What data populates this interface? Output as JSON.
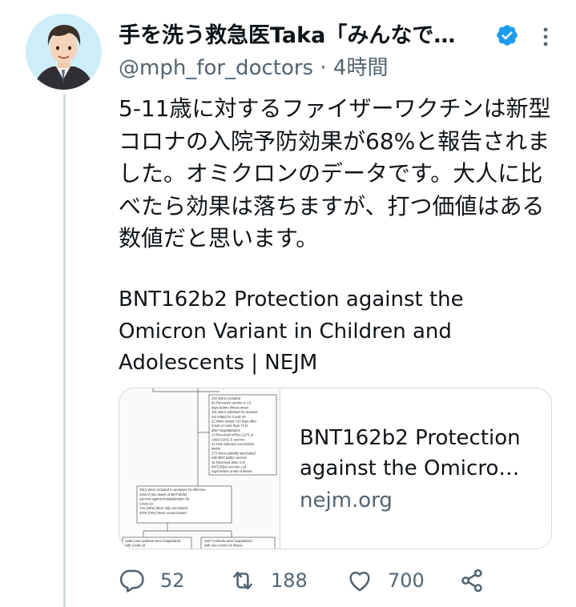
{
  "tweet": {
    "display_name": "手を洗う救急医Taka「みんなで…",
    "handle": "@mph_for_doctors",
    "separator": "·",
    "time": "4時間",
    "text": "5-11歳に対するファイザーワクチンは新型コロナの入院予防効果が68%と報告されました。オミクロンのデータです。大人に比べたら効果は落ちますが、打つ価値はある数値だと思います。",
    "link_title": "BNT162b2 Protection against the Omicron Variant in Children and Adolescents | NEJM"
  },
  "card": {
    "title_line1": "BNT162b2 Protection",
    "title_line2": "against the Omicro…",
    "domain": "nejm.org",
    "thumb": {
      "box1_lines": [
        "422 Were excluded",
        "60 Received vaccine 0–13",
        "days before illness onset",
        "101 Were admitted for reasons",
        "not related to Covid-19",
        "22 Were tested >10 days after",
        "onset or more than 72 hr",
        "after hospitalization",
        "13 Received mRNA-1273 or",
        "Ad26.COV2.S vaccine",
        "11 Had unknown vaccination",
        "status",
        "173 Were partially vaccinated",
        "with BNT162b2 vaccine",
        "42 Received dose 3 of",
        "BNT162b2 vaccine ≥14",
        "days before onset of illness"
      ],
      "box2_lines": [
        "2812 Were included in analyses for effective-",
        "ness of two doses of BNT162b2",
        "vaccine against hospitalization for",
        "Covid-19",
        "734 (26%) Were fully vaccinated",
        "2078 (74%) Were unvaccinated"
      ],
      "box3_lines": [
        "1185 Case patients were hospitalized",
        "with Covid-19"
      ],
      "box4_lines": [
        "1627 Controls were hospitalized",
        "with non–Covid-19 illness"
      ]
    }
  },
  "actions": {
    "replies": "52",
    "retweets": "188",
    "likes": "700"
  },
  "icons": {
    "verified": "verified-badge-icon",
    "more": "more-dots-icon",
    "reply": "reply-icon",
    "retweet": "retweet-icon",
    "like": "heart-icon",
    "share": "share-icon"
  },
  "colors": {
    "verified": "#1d9bf0",
    "secondary_text": "#536471",
    "thread_line": "#cfd9de"
  }
}
